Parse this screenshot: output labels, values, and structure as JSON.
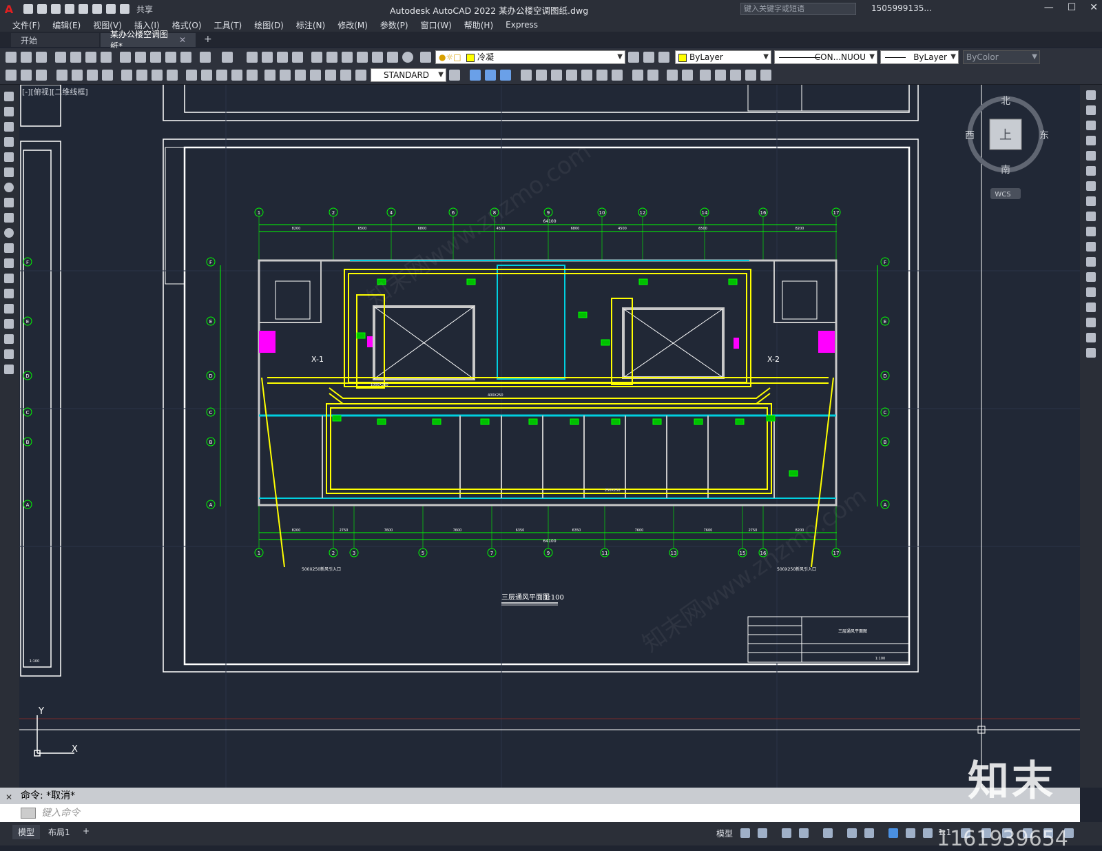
{
  "app": {
    "title": "Autodesk AutoCAD 2022    某办公楼空调图纸.dwg",
    "logo": "A",
    "share_label": "共享",
    "search_placeholder": "键入关键字或短语",
    "user": "1505999135..."
  },
  "menu": [
    "文件(F)",
    "编辑(E)",
    "视图(V)",
    "插入(I)",
    "格式(O)",
    "工具(T)",
    "绘图(D)",
    "标注(N)",
    "修改(M)",
    "参数(P)",
    "窗口(W)",
    "帮助(H)",
    "Express"
  ],
  "tabs": [
    {
      "label": "开始",
      "active": false
    },
    {
      "label": "某办公楼空调图纸*",
      "active": true
    }
  ],
  "toolbar": {
    "layer": "冷凝",
    "color": "ByLayer",
    "linetype": "CON...NUOU",
    "lineweight": "ByLayer",
    "plotstyle": "ByColor",
    "textstyle": "STANDARD"
  },
  "viewport": {
    "label": "[-][俯视][二维线框]",
    "compass": {
      "n": "北",
      "s": "南",
      "e": "东",
      "w": "西",
      "top": "上"
    },
    "wcs": "WCS",
    "axis_y": "Y",
    "axis_x": "X"
  },
  "drawing": {
    "title": "三层通风平面图",
    "scale": "1:100",
    "top_axes": [
      "1",
      "2",
      "4",
      "6",
      "8",
      "9",
      "10",
      "12",
      "14",
      "16",
      "17"
    ],
    "top_dims": [
      "8200",
      "6500",
      "6800",
      "4500",
      "6800",
      "4500",
      "6500",
      "8200"
    ],
    "total_dim": "64100",
    "bottom_axes": [
      "1",
      "2",
      "3",
      "5",
      "7",
      "9",
      "11",
      "13",
      "15",
      "16",
      "17"
    ],
    "bottom_dims": [
      "8200",
      "2750",
      "7600",
      "7600",
      "6350",
      "6350",
      "7600",
      "7600",
      "2750",
      "8200"
    ],
    "row_axes": [
      "F",
      "E",
      "D",
      "C",
      "B",
      "A"
    ],
    "riser_left": "X-1",
    "riser_right": "X-2",
    "notes": [
      "500X250新风引入口",
      "500X250新风引入口",
      "1000X250",
      "400X250",
      "250X250"
    ],
    "titleblock_small": "1:100",
    "titleblock_name": "三层通风平面图"
  },
  "command": {
    "history": "命令: *取消*",
    "placeholder": "键入命令"
  },
  "status": {
    "tabs": [
      "模型",
      "布局1"
    ],
    "model_label": "模型",
    "scale": "1:1"
  },
  "watermark": {
    "logo": "知末",
    "id": "ID: 1161939654",
    "repeat": "知末网www.znzmo.com"
  }
}
